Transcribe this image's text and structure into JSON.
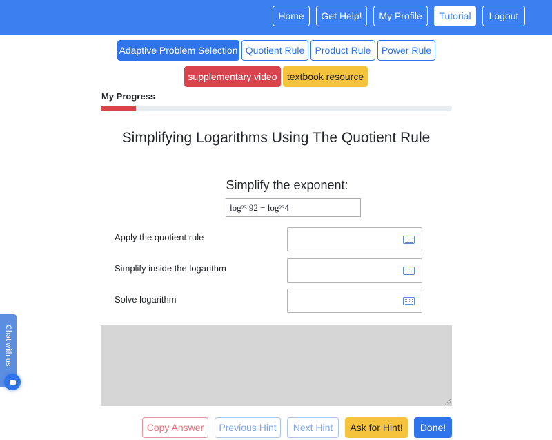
{
  "nav": {
    "home": "Home",
    "help": "Get Help!",
    "profile": "My Profile",
    "tutorial": "Tutorial",
    "logout": "Logout"
  },
  "tabs": {
    "adaptive": "Adaptive Problem Selection",
    "quotient": "Quotient Rule",
    "product": "Product Rule",
    "power": "Power Rule"
  },
  "resources": {
    "video": "supplementary video",
    "textbook": "textbook resource"
  },
  "progress": {
    "label": "My Progress",
    "value_percent": 10,
    "color": "#d9434e"
  },
  "problem": {
    "title": "Simplifying Logarithms Using The Quotient Rule",
    "instruction": "Simplify the exponent:",
    "expression": {
      "log1": "log",
      "base1": "23",
      "arg1": "92",
      "minus": "−",
      "log2": "log",
      "base2": "23",
      "arg2": "4"
    }
  },
  "steps": [
    {
      "label": "Apply the quotient rule",
      "value": "",
      "icon": "keyboard-icon"
    },
    {
      "label": "Simplify inside the logarithm",
      "value": "",
      "icon": "keyboard-icon"
    },
    {
      "label": "Solve logarithm",
      "value": "",
      "icon": "keyboard-icon"
    }
  ],
  "chat": {
    "label": "Chat with us",
    "icon": "chat-bubble-icon"
  },
  "actions": {
    "copy": "Copy Answer",
    "previous": "Previous Hint",
    "next": "Next Hint",
    "ask": "Ask for Hint!",
    "done": "Done!"
  },
  "colors": {
    "navbar": "#3b7ff0",
    "primary": "#2f74eb",
    "danger": "#d9434e",
    "warning": "#f6c33c"
  }
}
